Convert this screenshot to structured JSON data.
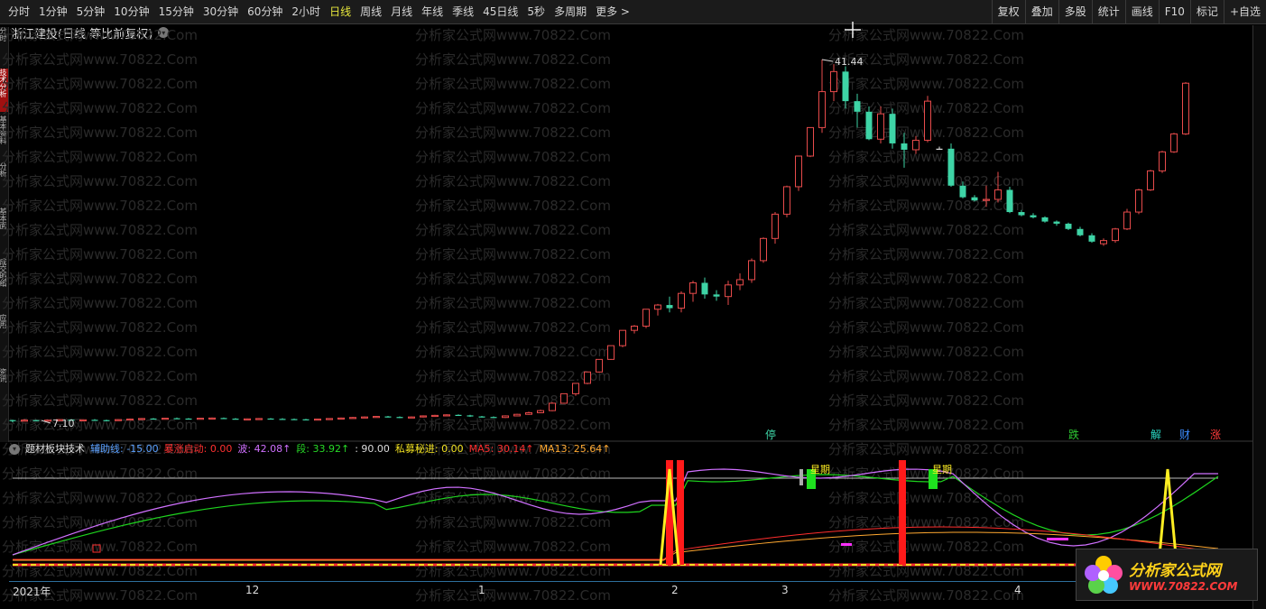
{
  "toolbar": {
    "periods": [
      "分时",
      "1分钟",
      "5分钟",
      "10分钟",
      "15分钟",
      "30分钟",
      "60分钟",
      "2小时",
      "日线",
      "周线",
      "月线",
      "年线",
      "季线",
      "45日线",
      "5秒",
      "多周期",
      "更多 >"
    ],
    "active_period": "日线",
    "right_items": [
      "复权",
      "叠加",
      "多股",
      "统计",
      "画线",
      "F10",
      "标记",
      "+自选"
    ]
  },
  "title": {
    "stock": "浙江建投(日线 等比前复权)"
  },
  "sidebar": {
    "items": [
      "分时",
      "技术分析",
      "基本资料",
      "分析",
      "基本面",
      "成交明细",
      "应用",
      "资讯"
    ]
  },
  "price": {
    "high_label": "41.44",
    "low_label": "7.10",
    "colors": {
      "up": "#e84b4b",
      "down": "#3ed4a6",
      "flat": "#dddddd"
    },
    "candles": [
      [
        7.3,
        7.35,
        7.1,
        7.28
      ],
      [
        7.28,
        7.4,
        7.2,
        7.3
      ],
      [
        7.3,
        7.32,
        7.2,
        7.25
      ],
      [
        7.25,
        7.35,
        7.2,
        7.3
      ],
      [
        7.3,
        7.4,
        7.25,
        7.35
      ],
      [
        7.35,
        7.4,
        7.25,
        7.3
      ],
      [
        7.3,
        7.38,
        7.25,
        7.33
      ],
      [
        7.33,
        7.4,
        7.28,
        7.3
      ],
      [
        7.3,
        7.35,
        7.2,
        7.28
      ],
      [
        7.28,
        7.4,
        7.25,
        7.35
      ],
      [
        7.35,
        7.45,
        7.3,
        7.4
      ],
      [
        7.4,
        7.5,
        7.35,
        7.45
      ],
      [
        7.45,
        7.5,
        7.35,
        7.4
      ],
      [
        7.4,
        7.5,
        7.38,
        7.48
      ],
      [
        7.48,
        7.55,
        7.4,
        7.45
      ],
      [
        7.45,
        7.5,
        7.38,
        7.42
      ],
      [
        7.42,
        7.5,
        7.4,
        7.48
      ],
      [
        7.48,
        7.55,
        7.42,
        7.5
      ],
      [
        7.5,
        7.55,
        7.4,
        7.44
      ],
      [
        7.44,
        7.5,
        7.38,
        7.4
      ],
      [
        7.4,
        7.45,
        7.35,
        7.42
      ],
      [
        7.42,
        7.5,
        7.38,
        7.45
      ],
      [
        7.45,
        7.5,
        7.4,
        7.42
      ],
      [
        7.42,
        7.48,
        7.38,
        7.4
      ],
      [
        7.4,
        7.45,
        7.35,
        7.38
      ],
      [
        7.38,
        7.42,
        7.3,
        7.35
      ],
      [
        7.35,
        7.42,
        7.3,
        7.4
      ],
      [
        7.4,
        7.48,
        7.38,
        7.45
      ],
      [
        7.45,
        7.55,
        7.4,
        7.5
      ],
      [
        7.5,
        7.6,
        7.45,
        7.55
      ],
      [
        7.55,
        7.65,
        7.5,
        7.6
      ],
      [
        7.6,
        7.7,
        7.55,
        7.65
      ],
      [
        7.65,
        7.7,
        7.55,
        7.6
      ],
      [
        7.6,
        7.65,
        7.5,
        7.55
      ],
      [
        7.55,
        7.65,
        7.5,
        7.6
      ],
      [
        7.6,
        7.75,
        7.55,
        7.7
      ],
      [
        7.7,
        7.8,
        7.65,
        7.75
      ],
      [
        7.75,
        7.85,
        7.7,
        7.8
      ],
      [
        7.8,
        7.85,
        7.7,
        7.75
      ],
      [
        7.75,
        7.8,
        7.6,
        7.65
      ],
      [
        7.65,
        7.7,
        7.55,
        7.6
      ],
      [
        7.6,
        7.65,
        7.5,
        7.55
      ],
      [
        7.55,
        7.75,
        7.5,
        7.7
      ],
      [
        7.7,
        7.9,
        7.65,
        7.85
      ],
      [
        7.85,
        8.1,
        7.8,
        8.0
      ],
      [
        8.0,
        8.3,
        7.95,
        8.2
      ],
      [
        8.2,
        9.0,
        8.15,
        8.9
      ],
      [
        8.9,
        9.8,
        8.85,
        9.8
      ],
      [
        9.8,
        10.8,
        9.6,
        10.78
      ],
      [
        10.78,
        11.86,
        10.7,
        11.86
      ],
      [
        11.86,
        13.05,
        11.8,
        13.05
      ],
      [
        13.05,
        14.35,
        13.0,
        14.35
      ],
      [
        14.35,
        15.8,
        14.2,
        15.8
      ],
      [
        15.8,
        16.3,
        15.5,
        16.2
      ],
      [
        16.2,
        17.8,
        16.0,
        17.8
      ],
      [
        17.8,
        18.3,
        17.2,
        18.2
      ],
      [
        18.2,
        19.0,
        17.5,
        17.9
      ],
      [
        17.9,
        19.5,
        17.5,
        19.3
      ],
      [
        19.3,
        20.5,
        18.5,
        20.3
      ],
      [
        20.3,
        20.8,
        18.8,
        19.2
      ],
      [
        19.2,
        19.6,
        18.6,
        19.0
      ],
      [
        19.0,
        20.5,
        18.2,
        20.1
      ],
      [
        20.1,
        21.2,
        19.6,
        20.6
      ],
      [
        20.6,
        22.6,
        20.3,
        22.4
      ],
      [
        22.4,
        24.6,
        22.2,
        24.5
      ],
      [
        24.5,
        27.0,
        24.0,
        26.8
      ],
      [
        26.8,
        29.5,
        26.5,
        29.4
      ],
      [
        29.4,
        32.3,
        29.0,
        32.3
      ],
      [
        32.3,
        35.0,
        32.2,
        35.0
      ],
      [
        35.0,
        41.44,
        34.5,
        38.4
      ],
      [
        38.4,
        41.0,
        37.5,
        40.3
      ],
      [
        40.3,
        40.8,
        36.8,
        37.5
      ],
      [
        37.5,
        38.2,
        35.0,
        36.5
      ],
      [
        36.5,
        37.0,
        33.8,
        33.9
      ],
      [
        33.9,
        37.0,
        33.5,
        36.3
      ],
      [
        36.3,
        36.8,
        33.0,
        33.5
      ],
      [
        33.5,
        34.5,
        31.2,
        32.9
      ],
      [
        32.9,
        34.2,
        32.5,
        33.8
      ],
      [
        33.8,
        38.0,
        33.6,
        37.5
      ],
      [
        33.0,
        33.2,
        32.9,
        33.0
      ],
      [
        33.0,
        33.5,
        29.4,
        29.5
      ],
      [
        29.5,
        29.9,
        28.3,
        28.4
      ],
      [
        28.4,
        28.6,
        28.0,
        28.1
      ],
      [
        28.1,
        29.5,
        27.5,
        28.2
      ],
      [
        28.2,
        30.8,
        27.9,
        29.1
      ],
      [
        29.1,
        29.4,
        26.9,
        27.0
      ],
      [
        27.0,
        27.2,
        26.6,
        26.7
      ],
      [
        26.7,
        26.9,
        26.4,
        26.5
      ],
      [
        26.5,
        26.6,
        26.0,
        26.1
      ],
      [
        26.1,
        26.2,
        25.7,
        25.9
      ],
      [
        25.9,
        26.0,
        25.3,
        25.4
      ],
      [
        25.4,
        25.6,
        24.7,
        24.8
      ],
      [
        24.8,
        25.0,
        24.1,
        24.2
      ],
      [
        24.0,
        24.5,
        23.8,
        24.3
      ],
      [
        24.3,
        25.5,
        24.1,
        25.4
      ],
      [
        25.4,
        27.3,
        25.3,
        27.0
      ],
      [
        27.0,
        29.2,
        26.8,
        29.1
      ],
      [
        29.1,
        31.0,
        29.0,
        30.9
      ],
      [
        30.9,
        32.8,
        30.7,
        32.7
      ],
      [
        32.7,
        34.5,
        32.6,
        34.4
      ],
      [
        34.4,
        39.3,
        34.3,
        39.2
      ]
    ],
    "signals": [
      {
        "label": "停",
        "color": "#3ed4a6"
      },
      {
        "label": "跌",
        "color": "#2ec832"
      },
      {
        "label": "解",
        "color": "#2ad6c2"
      },
      {
        "label": "财",
        "color": "#3c8cff"
      },
      {
        "label": "涨",
        "color": "#ff3b3b"
      }
    ]
  },
  "indicator": {
    "name": "题材板块技术",
    "params": [
      {
        "label": "辅助线: -15.00",
        "color": "#5aa0ff"
      },
      {
        "label": "暴涨启动: 0.00",
        "color": "#ff3030"
      },
      {
        "label": "波: 42.08↑",
        "color": "#d070ff"
      },
      {
        "label": "段: 33.92↑",
        "color": "#27d827"
      },
      {
        "label": ": 90.00",
        "color": "#dddddd"
      },
      {
        "label": "私募秘进: 0.00",
        "color": "#f0e020"
      },
      {
        "label": "MA5: 30.14↑",
        "color": "#ff2d2d"
      },
      {
        "label": "MA13: 25.64↑",
        "color": "#ffa830"
      }
    ],
    "tags": [
      "星期",
      "星期"
    ]
  },
  "axis": {
    "labels": [
      "2021年",
      "12",
      "1",
      "2",
      "3",
      "4"
    ]
  },
  "watermark": "分析家公式网www.70822.Com",
  "logo": {
    "line1": "分析家公式网",
    "line2": "WWW.70822.COM"
  }
}
